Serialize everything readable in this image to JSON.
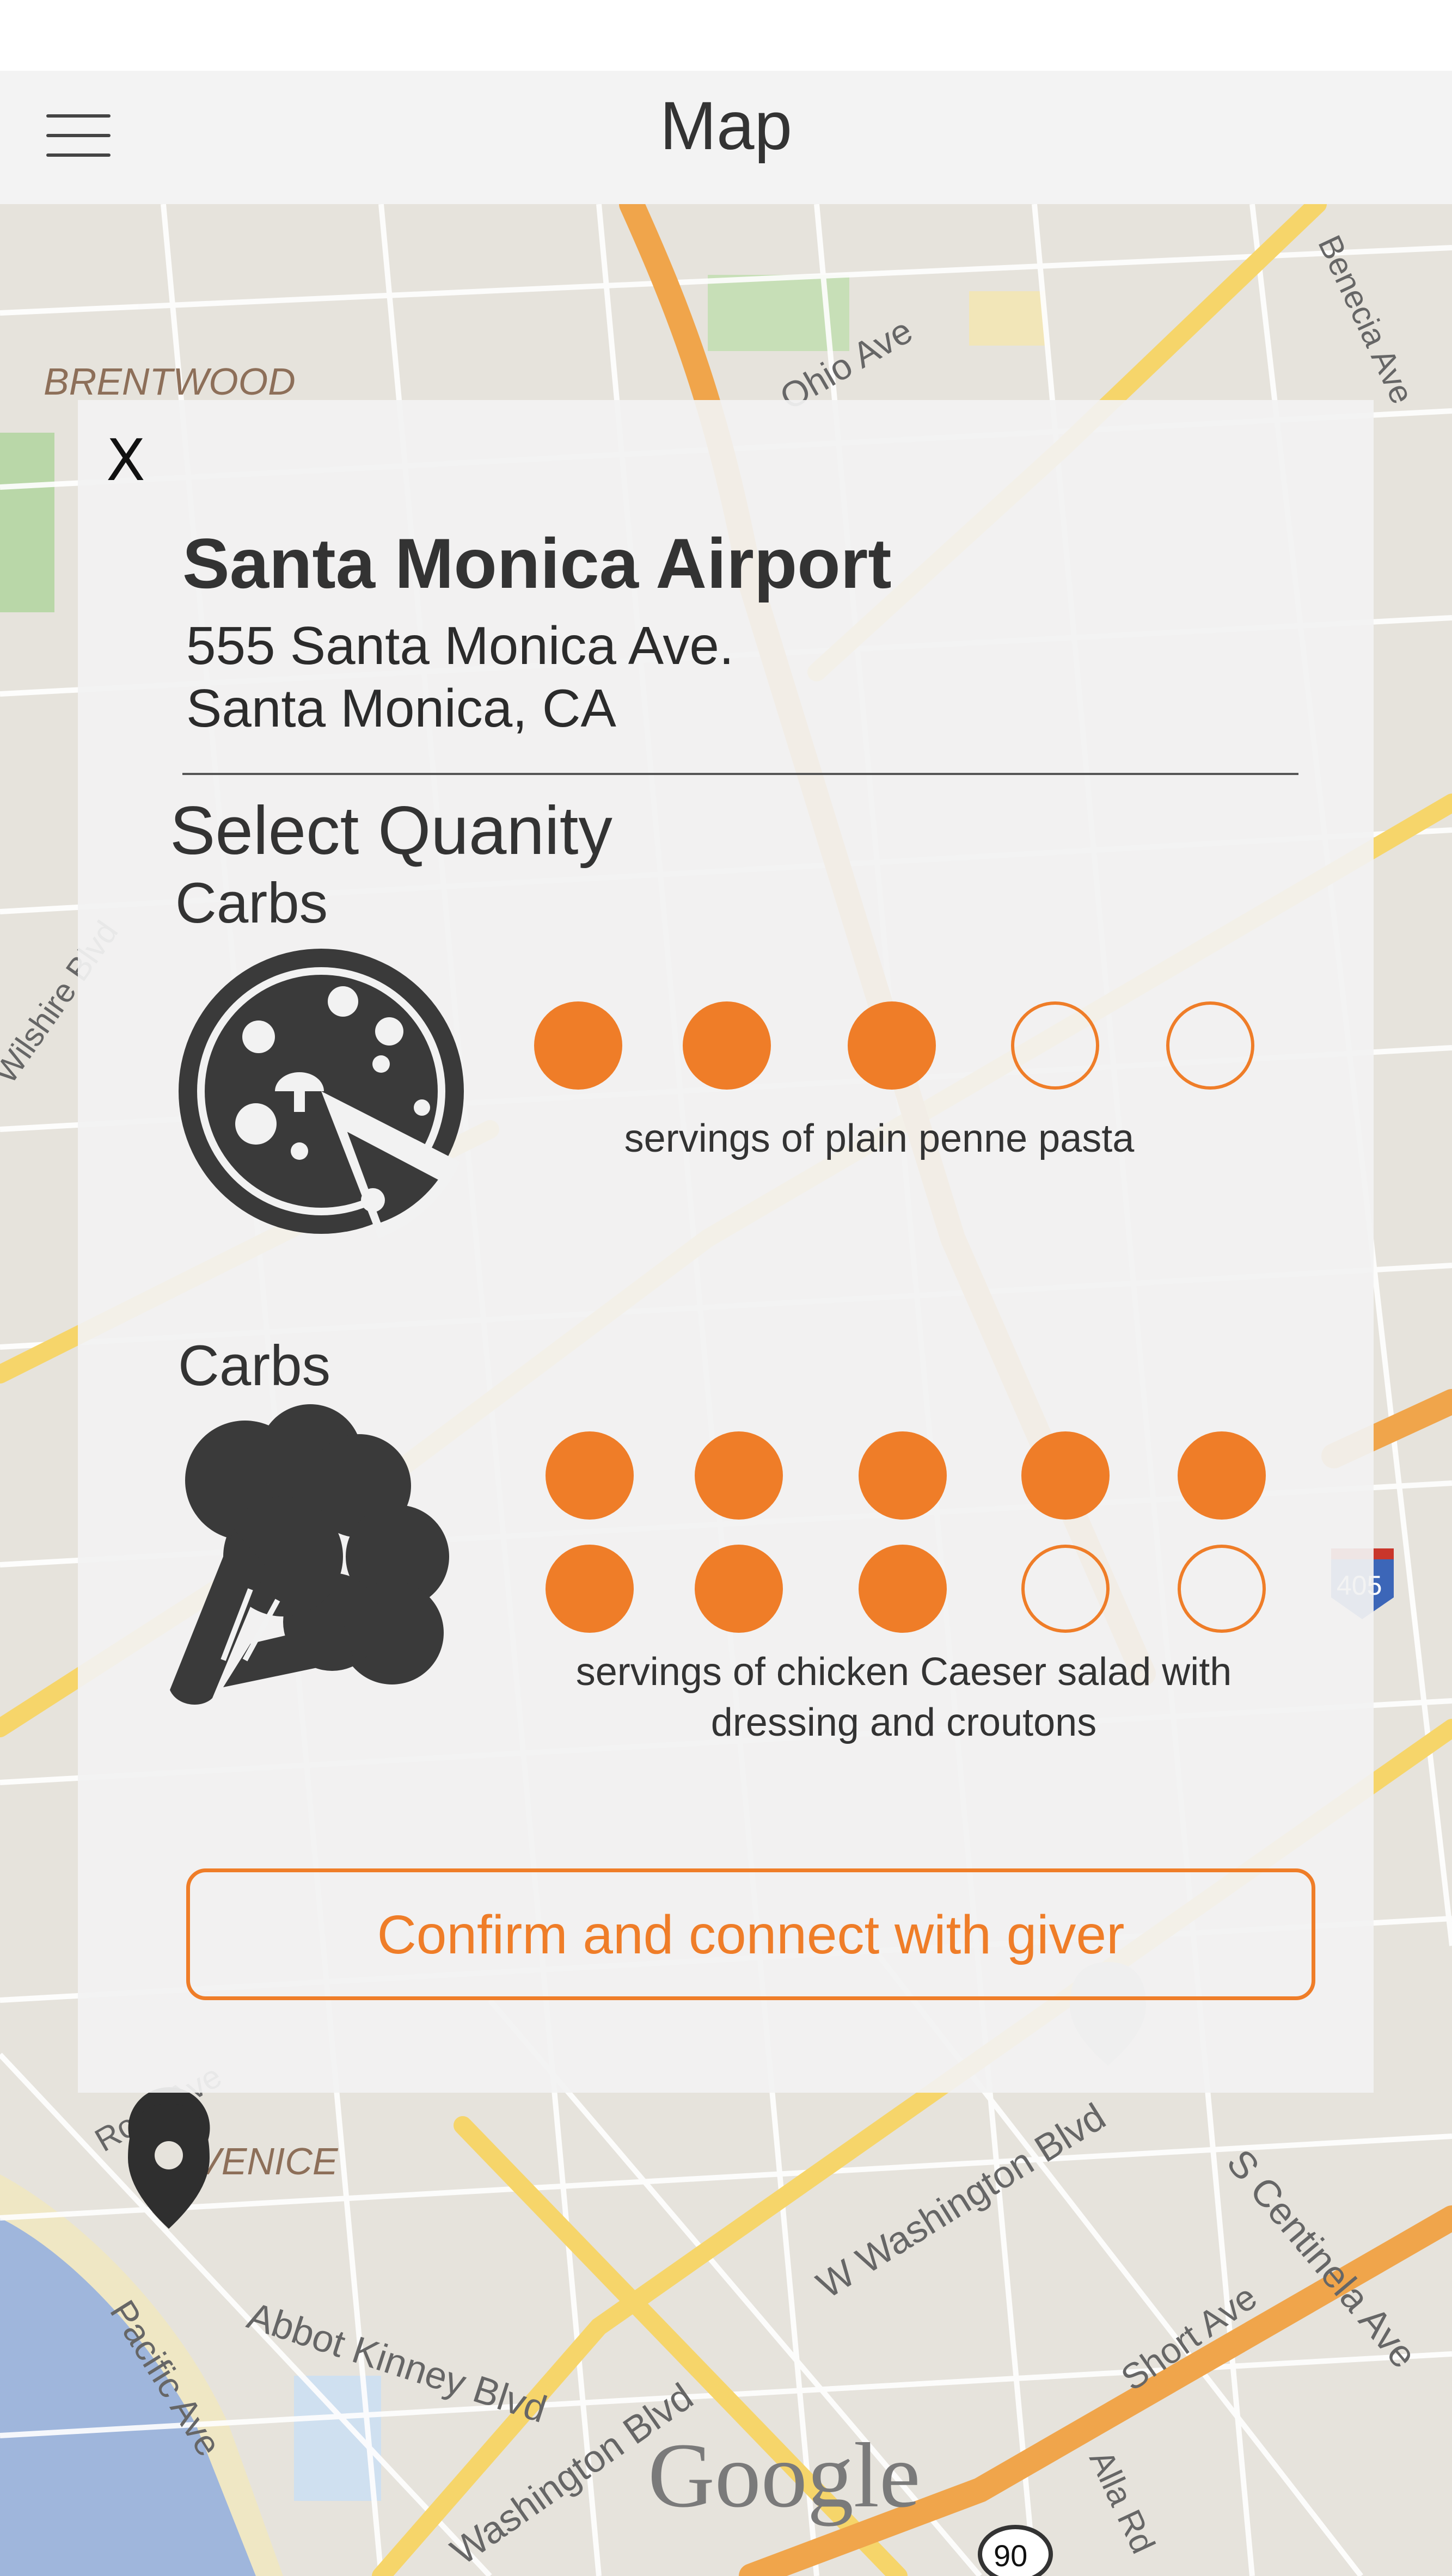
{
  "header": {
    "title": "Map",
    "menu_icon": "hamburger-menu-icon"
  },
  "map": {
    "labels": {
      "brentwood": "BRENTWOOD",
      "venice": "VENICE",
      "google": "Google",
      "abbot_kinney": "Abbot Kinney Blvd",
      "pacific_ave": "Pacific Ave",
      "w_washington": "W Washington Blvd",
      "washington_blvd": "Washington Blvd",
      "s_centinela": "S Centinela Ave",
      "short_ave": "Short Ave",
      "alla_rd": "Alla Rd",
      "rose_ave": "Rose Ave",
      "benecia_ave": "Benecia Ave",
      "ohio_ave": "Ohio Ave",
      "wilshire": "Wilshire Blvd",
      "route_90": "90",
      "route_405": "405"
    },
    "pin_icon": "map-pin-icon"
  },
  "modal": {
    "close_label": "X",
    "place_name": "Santa Monica Airport",
    "address_line1": "555 Santa Monica Ave.",
    "address_line2": "Santa Monica, CA",
    "section_title": "Select Quanity",
    "items": [
      {
        "category": "Carbs",
        "icon": "pizza-icon",
        "filled": 3,
        "total": 5,
        "description": "servings of plain penne pasta"
      },
      {
        "category": "Carbs",
        "icon": "broccoli-icon",
        "filled": 8,
        "total": 10,
        "description_line1": "servings of chicken Caeser salad with",
        "description_line2": "dressing and croutons"
      }
    ],
    "confirm_label": "Confirm and connect with giver"
  },
  "colors": {
    "accent": "#ef7d28",
    "dark_icon": "#3a3a3a",
    "header_bg": "#f3f3f3"
  }
}
